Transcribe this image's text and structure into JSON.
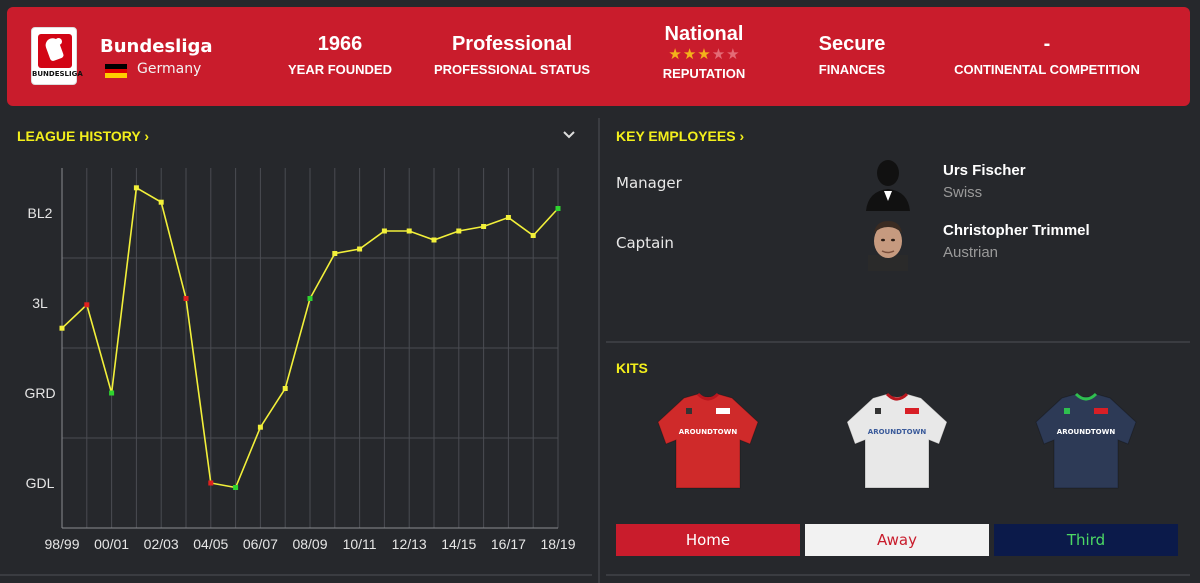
{
  "header": {
    "logo_text": "BUNDESLIGA",
    "league_name": "Bundesliga",
    "country": "Germany",
    "stats": [
      {
        "value": "1966",
        "label": "YEAR FOUNDED"
      },
      {
        "value": "Professional",
        "label": "PROFESSIONAL STATUS"
      },
      {
        "value": "National",
        "label": "REPUTATION",
        "stars": 3,
        "max_stars": 5
      },
      {
        "value": "Secure",
        "label": "FINANCES"
      },
      {
        "value": "-",
        "label": "CONTINENTAL COMPETITION"
      }
    ],
    "colors": {
      "header_bg": "#c91c2c"
    }
  },
  "league_history": {
    "title": "LEAGUE HISTORY ›",
    "collapse_icon": "chevron-down-icon"
  },
  "chart_data": {
    "type": "line",
    "y_categories": [
      "BL2",
      "3L",
      "GRD",
      "GDL"
    ],
    "y_scale_note": "lower is higher division; league levels 2-5",
    "x_labels": [
      "98/99",
      "00/01",
      "02/03",
      "04/05",
      "06/07",
      "08/09",
      "10/11",
      "12/13",
      "14/15",
      "16/17",
      "18/19"
    ],
    "seasons": [
      "98/99",
      "99/00",
      "00/01",
      "01/02",
      "02/03",
      "03/04",
      "04/05",
      "05/06",
      "06/07",
      "07/08",
      "08/09",
      "09/10",
      "10/11",
      "11/12",
      "12/13",
      "13/14",
      "14/15",
      "15/16",
      "16/17",
      "17/18",
      "18/19"
    ],
    "values": [
      3.28,
      3.02,
      4.0,
      1.72,
      1.88,
      2.95,
      5.0,
      5.05,
      4.38,
      3.95,
      2.95,
      2.45,
      2.4,
      2.2,
      2.2,
      2.3,
      2.2,
      2.15,
      2.05,
      2.25,
      1.95
    ],
    "point_status": [
      "neutral",
      "relegated",
      "promoted",
      "neutral",
      "neutral",
      "relegated",
      "relegated",
      "promoted",
      "neutral",
      "neutral",
      "promoted",
      "neutral",
      "neutral",
      "neutral",
      "neutral",
      "neutral",
      "neutral",
      "neutral",
      "neutral",
      "neutral",
      "promoted"
    ],
    "colors": {
      "line": "#f2f03a",
      "neutral": "#f2f03a",
      "promoted": "#2fd42f",
      "relegated": "#e0201e"
    },
    "grid": true
  },
  "key_employees": {
    "title": "KEY EMPLOYEES ›",
    "people": [
      {
        "role": "Manager",
        "name": "Urs Fischer",
        "nationality": "Swiss"
      },
      {
        "role": "Captain",
        "name": "Christopher Trimmel",
        "nationality": "Austrian"
      }
    ]
  },
  "kits": {
    "title": "KITS",
    "sponsor": "AROUNDTOWN",
    "items": [
      {
        "label": "Home",
        "shirt_color": "#cf2a2a",
        "btn_bg": "#c91c2c",
        "btn_color": "#ffffff"
      },
      {
        "label": "Away",
        "shirt_color": "#e8e8e8",
        "btn_bg": "#f2f2f2",
        "btn_color": "#c91c2c"
      },
      {
        "label": "Third",
        "shirt_color": "#2d3a56",
        "btn_bg": "#0b1a4a",
        "btn_color": "#4cd964"
      }
    ]
  }
}
